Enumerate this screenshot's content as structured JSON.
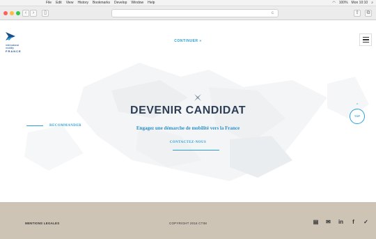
{
  "menubar": {
    "items": [
      "File",
      "Edit",
      "View",
      "History",
      "Bookmarks",
      "Develop",
      "Window",
      "Help"
    ],
    "battery": "100%",
    "clock": "Mon 10:10"
  },
  "browser": {
    "url_hint": "c"
  },
  "header": {
    "logo_line1": "international",
    "logo_line2": "mobility",
    "logo_line3": "FRANCE",
    "continue_label": "CONTINUER  »"
  },
  "hero": {
    "title": "DEVENIR CANDIDAT",
    "subtitle": "Engagez une démarche de mobilité vers la France",
    "contact_label": "CONTACTEZ-NOUS"
  },
  "side": {
    "recommend_label": "RECOMMANDER",
    "top_arrow": "^",
    "top_label": "TOP"
  },
  "footer": {
    "legal_label": "MENTIONS LEGALES",
    "copyright": "COPYRIGHT 2016 CTIM",
    "social": {
      "rss": "▤",
      "chat": "✉",
      "linkedin": "in",
      "facebook": "f",
      "twitter": "✓"
    }
  },
  "colors": {
    "accent": "#2a9fd6",
    "title": "#2d3e55",
    "footer_bg": "#cec4b6",
    "logo": "#1a4e8a"
  }
}
